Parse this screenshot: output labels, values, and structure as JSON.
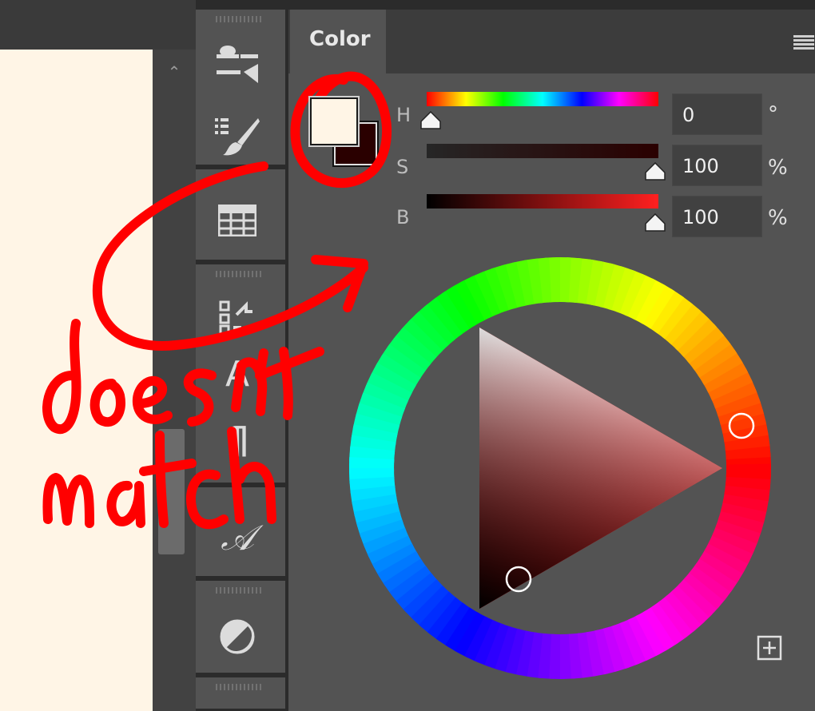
{
  "panel": {
    "tab_label": "Color",
    "menu_icon": "hamburger-icon"
  },
  "swatches": {
    "foreground_color": "#fff5e6",
    "background_color": "#2a0000"
  },
  "sliders": [
    {
      "label": "H",
      "value": "0",
      "unit": "°"
    },
    {
      "label": "S",
      "value": "100",
      "unit": "%"
    },
    {
      "label": "B",
      "value": "100",
      "unit": "%"
    }
  ],
  "dock_icons": [
    "brush-settings-icon",
    "brushes-icon",
    "swatches-grid-icon",
    "properties-icon",
    "character-icon",
    "paragraph-icon",
    "glyphs-icon",
    "adjustments-icon"
  ],
  "dock_glyphs": {
    "character": "A",
    "paragraph": "¶",
    "glyphs": "𝒜"
  },
  "color_wheel": {
    "hue": 0,
    "selected_hue_color": "#ff0000"
  },
  "annotation": {
    "text": "doesn't match",
    "color": "#ff0000"
  },
  "add_button_icon": "plus-square-icon"
}
